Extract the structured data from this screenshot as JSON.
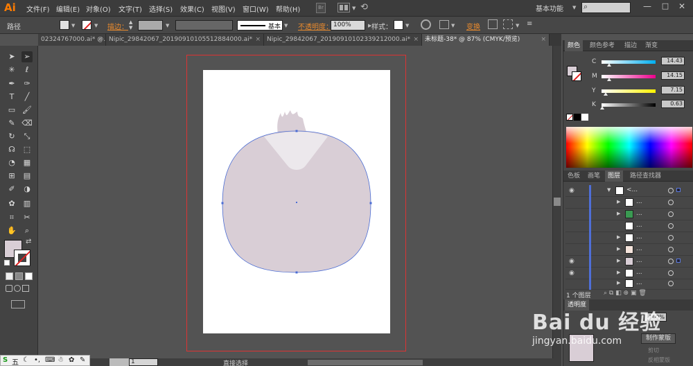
{
  "app": {
    "logo": "Ai"
  },
  "menu": [
    "文件(F)",
    "编辑(E)",
    "对象(O)",
    "文字(T)",
    "选择(S)",
    "效果(C)",
    "视图(V)",
    "窗口(W)",
    "帮助(H)"
  ],
  "menu_icons": {
    "doc": "Br"
  },
  "workspace": {
    "label": "基本功能",
    "search_placeholder": ""
  },
  "window_controls": {
    "minimize": "—",
    "maximize": "□",
    "close": "✕"
  },
  "control_bar": {
    "selection_type": "路径",
    "stroke_label": "描边：",
    "brush_label": "基本",
    "opacity_label": "不透明度：",
    "opacity_value": "100%",
    "style_label": "样式：",
    "transform_label": "变换",
    "fill_color": "#e0e0e0"
  },
  "tabs": [
    {
      "label": "02324767000.ai* @...",
      "active": false
    },
    {
      "label": "Nipic_29842067_20190910105512884000.ai*",
      "active": false
    },
    {
      "label": "Nipic_29842067_20190910102339212000.ai*",
      "active": false
    },
    {
      "label": "未标题-38* @ 87% (CMYK/预览)",
      "active": true
    }
  ],
  "tools": {
    "fill_color": "#d9ced6",
    "icons": [
      "selection-icon",
      "direct-selection-icon",
      "magic-wand-icon",
      "lasso-icon",
      "pen-icon",
      "curvature-icon",
      "type-icon",
      "line-icon",
      "rectangle-icon",
      "paintbrush-icon",
      "pencil-icon",
      "eraser-icon",
      "rotate-icon",
      "scale-icon",
      "warp-icon",
      "free-transform-icon",
      "shape-builder-icon",
      "perspective-icon",
      "mesh-icon",
      "gradient-icon",
      "eyedropper-icon",
      "blend-icon",
      "symbol-sprayer-icon",
      "column-graph-icon",
      "artboard-icon",
      "slice-icon",
      "hand-icon",
      "zoom-icon"
    ]
  },
  "color_panel": {
    "tabs": [
      "颜色",
      "颜色参考",
      "描边",
      "渐变"
    ],
    "channels": [
      {
        "label": "C",
        "value": "14.43",
        "fraction": 0.14
      },
      {
        "label": "M",
        "value": "14.15",
        "fraction": 0.14
      },
      {
        "label": "Y",
        "value": "7.15",
        "fraction": 0.07
      },
      {
        "label": "K",
        "value": "0.63",
        "fraction": 0.01
      }
    ],
    "fill_color": "#d9ced6"
  },
  "layers_panel": {
    "tabs": [
      "色板",
      "画笔",
      "图层",
      "路径查找器"
    ],
    "rows": [
      {
        "name": "<...",
        "visible": true,
        "expanded": true,
        "thumb": "#ffffff"
      },
      {
        "name": "...",
        "visible": false,
        "expanded": false,
        "thumb": "#ffffff"
      },
      {
        "name": "...",
        "visible": false,
        "expanded": false,
        "thumb": "#3a9a52"
      },
      {
        "name": "...",
        "visible": false,
        "expanded": false,
        "thumb": "#ffffff"
      },
      {
        "name": "...",
        "visible": false,
        "expanded": false,
        "thumb": "#ffffff"
      },
      {
        "name": "...",
        "visible": false,
        "expanded": false,
        "thumb": "#f5e4dc"
      },
      {
        "name": "...",
        "visible": true,
        "expanded": false,
        "thumb": "#d9ced6"
      },
      {
        "name": "...",
        "visible": true,
        "expanded": false,
        "thumb": "#ffffff"
      },
      {
        "name": "...",
        "visible": false,
        "expanded": false,
        "thumb": "#ffffff"
      }
    ],
    "count_label": "1 个图层"
  },
  "transparency_panel": {
    "title": "透明度",
    "opacity": "100%",
    "make_mask": "制作蒙版",
    "clip": "剪切",
    "invert": "反相蒙版"
  },
  "status": {
    "zoom": "87%",
    "page": "1",
    "tool_name": "直接选择"
  },
  "watermark": {
    "brand": "Bai du 经验",
    "url": "jingyan.baidu.com"
  },
  "ime": {
    "label": "五"
  },
  "art": {
    "head_color": "#d9ced6",
    "highlight_color": "#ece8ec",
    "path_color": "#4a6cd4"
  }
}
